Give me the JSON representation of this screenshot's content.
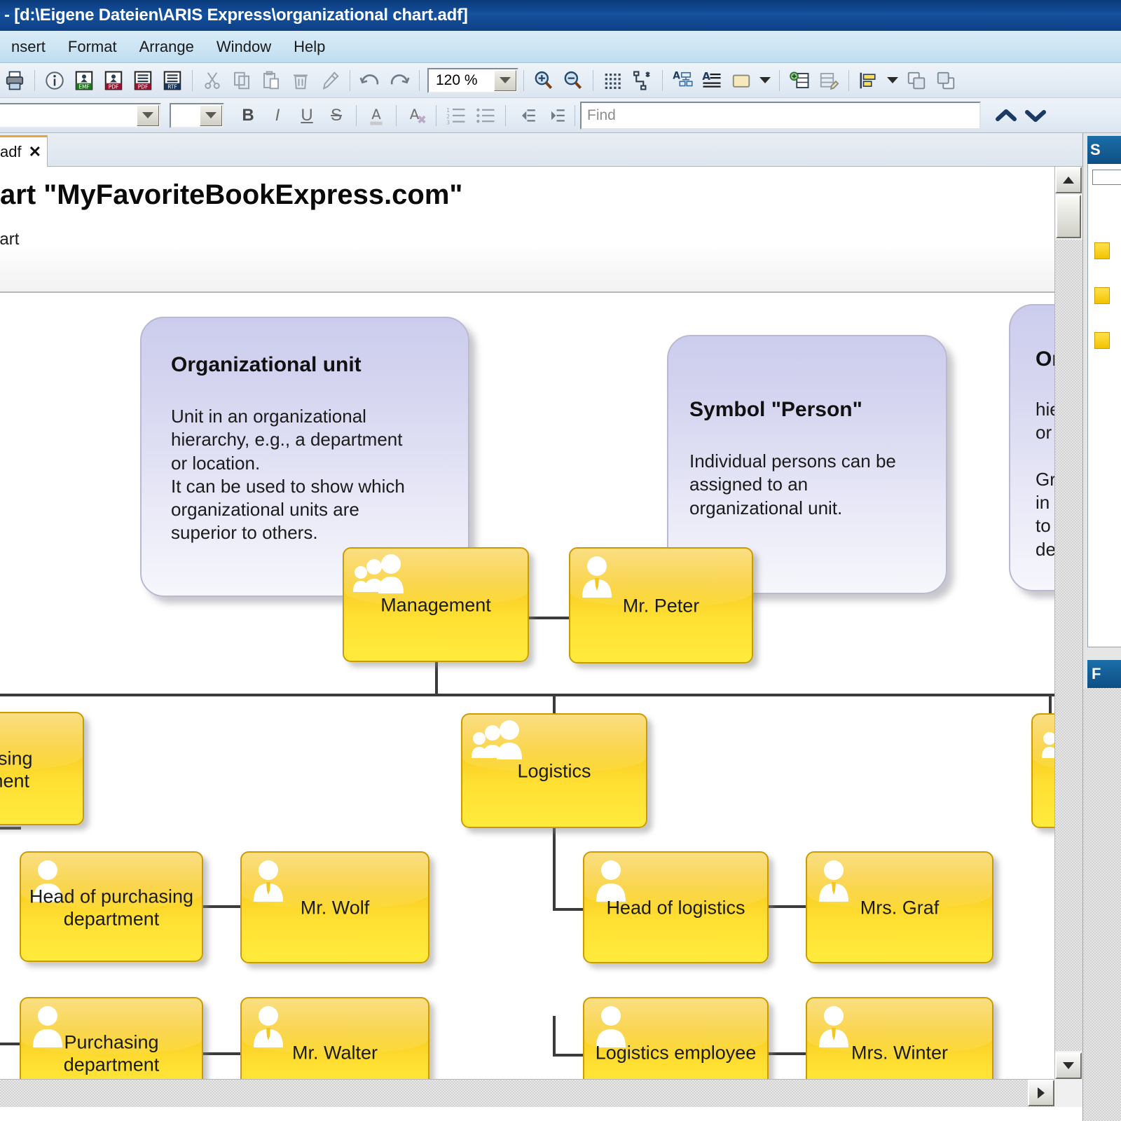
{
  "window": {
    "title": "- [d:\\Eigene Dateien\\ARIS Express\\organizational chart.adf]"
  },
  "menu": {
    "items": [
      {
        "label": "nsert",
        "name": "menu-insert"
      },
      {
        "label": "Format",
        "name": "menu-format"
      },
      {
        "label": "Arrange",
        "name": "menu-arrange"
      },
      {
        "label": "Window",
        "name": "menu-window"
      },
      {
        "label": "Help",
        "name": "menu-help"
      }
    ]
  },
  "toolbar": {
    "zoom_value": "120 %",
    "buttons": [
      {
        "name": "print-icon",
        "title": "Print"
      },
      {
        "name": "info-icon",
        "title": "Info"
      },
      {
        "name": "export-emf-icon",
        "title": "EMF"
      },
      {
        "name": "export-pdf-icon",
        "title": "PDF"
      },
      {
        "name": "export-pdf2-icon",
        "title": "PDF"
      },
      {
        "name": "export-rtf-icon",
        "title": "RTF"
      },
      {
        "name": "cut-icon",
        "title": "Cut"
      },
      {
        "name": "copy-icon",
        "title": "Copy"
      },
      {
        "name": "paste-icon",
        "title": "Paste"
      },
      {
        "name": "delete-icon",
        "title": "Delete"
      },
      {
        "name": "format-painter-icon",
        "title": "Format painter"
      },
      {
        "name": "undo-icon",
        "title": "Undo"
      },
      {
        "name": "redo-icon",
        "title": "Redo"
      },
      {
        "name": "zoom-in-icon",
        "title": "Zoom in"
      },
      {
        "name": "zoom-out-icon",
        "title": "Zoom out"
      },
      {
        "name": "grid-icon",
        "title": "Grid"
      },
      {
        "name": "connection-icon",
        "title": "Connections"
      },
      {
        "name": "align-text-icon",
        "title": "Text alignment"
      },
      {
        "name": "text-format-icon",
        "title": "Text format"
      },
      {
        "name": "fill-color-icon",
        "title": "Fill colour"
      },
      {
        "name": "fill-color-dropdown-icon",
        "title": "Fill colour options"
      },
      {
        "name": "add-attribute-icon",
        "title": "Add attribute"
      },
      {
        "name": "edit-attribute-icon",
        "title": "Edit attribute"
      },
      {
        "name": "align-objects-icon",
        "title": "Align"
      },
      {
        "name": "align-dropdown-icon",
        "title": "Align options"
      },
      {
        "name": "bring-front-icon",
        "title": "Bring to front"
      },
      {
        "name": "send-back-icon",
        "title": "Send to back"
      }
    ]
  },
  "format_bar": {
    "font_value": "",
    "size_value": "",
    "bold": "B",
    "italic": "I",
    "underline": "U",
    "strikethrough": "S",
    "font_color": "A",
    "clear_format": "A",
    "find_placeholder": "Find",
    "find_value": ""
  },
  "tab": {
    "label": "adf",
    "close": "✕"
  },
  "document": {
    "heading": "onal chart \"MyFavoriteBookExpress.com\"",
    "subheading": "onal chart"
  },
  "notes": [
    {
      "title": "Organizational unit",
      "body": "Unit in an organizational\nhierarchy, e.g., a department\nor location.\nIt can be used to show which\norganizational units are\nsuperior to others."
    },
    {
      "title": "Symbol \"Person\"",
      "body": "Individual persons can be\nassigned to an\norganizational unit."
    },
    {
      "title": "Or",
      "body": "hie\nor\n\nGr\nin\nto\nde"
    }
  ],
  "chart_data": {
    "type": "diagram",
    "title": "Organizational chart \"MyFavoriteBookExpress.com\"",
    "nodes": [
      {
        "id": "management",
        "label": "Management",
        "symbol": "org-unit"
      },
      {
        "id": "mr-peter",
        "label": "Mr. Peter",
        "symbol": "person-tie"
      },
      {
        "id": "purchasing-u",
        "label": "asing\nment",
        "symbol": "org-unit"
      },
      {
        "id": "logistics",
        "label": "Logistics",
        "symbol": "org-unit"
      },
      {
        "id": "right-unit",
        "label": "",
        "symbol": "org-unit"
      },
      {
        "id": "head-purch",
        "label": "Head of purchasing\ndepartment",
        "symbol": "person-plain"
      },
      {
        "id": "mr-wolf",
        "label": "Mr. Wolf",
        "symbol": "person-tie"
      },
      {
        "id": "head-log",
        "label": "Head of logistics",
        "symbol": "person-plain"
      },
      {
        "id": "mrs-graf",
        "label": "Mrs. Graf",
        "symbol": "person-tie"
      },
      {
        "id": "purch-dept",
        "label": "Purchasing\ndepartment",
        "symbol": "person-plain"
      },
      {
        "id": "mr-walter",
        "label": "Mr. Walter",
        "symbol": "person-tie"
      },
      {
        "id": "log-emp",
        "label": "Logistics employee",
        "symbol": "person-plain"
      },
      {
        "id": "mrs-winter",
        "label": "Mrs. Winter",
        "symbol": "person-tie"
      }
    ],
    "edges": [
      [
        "management",
        "mr-peter"
      ],
      [
        "management",
        "purchasing-u"
      ],
      [
        "management",
        "logistics"
      ],
      [
        "management",
        "right-unit"
      ],
      [
        "head-purch",
        "mr-wolf"
      ],
      [
        "head-log",
        "mrs-graf"
      ],
      [
        "purch-dept",
        "mr-walter"
      ],
      [
        "log-emp",
        "mrs-winter"
      ],
      [
        "purchasing-u",
        "head-purch"
      ],
      [
        "purchasing-u",
        "purch-dept"
      ],
      [
        "logistics",
        "head-log"
      ],
      [
        "logistics",
        "log-emp"
      ]
    ]
  },
  "colors": {
    "node_fill": "#ffe033",
    "node_border": "#c99c06",
    "note_fill": "#d6d6f0",
    "titlebar": "#15519e",
    "accent_tab": "#e8a33d"
  },
  "dock": {
    "header": "S",
    "footer": "F"
  }
}
